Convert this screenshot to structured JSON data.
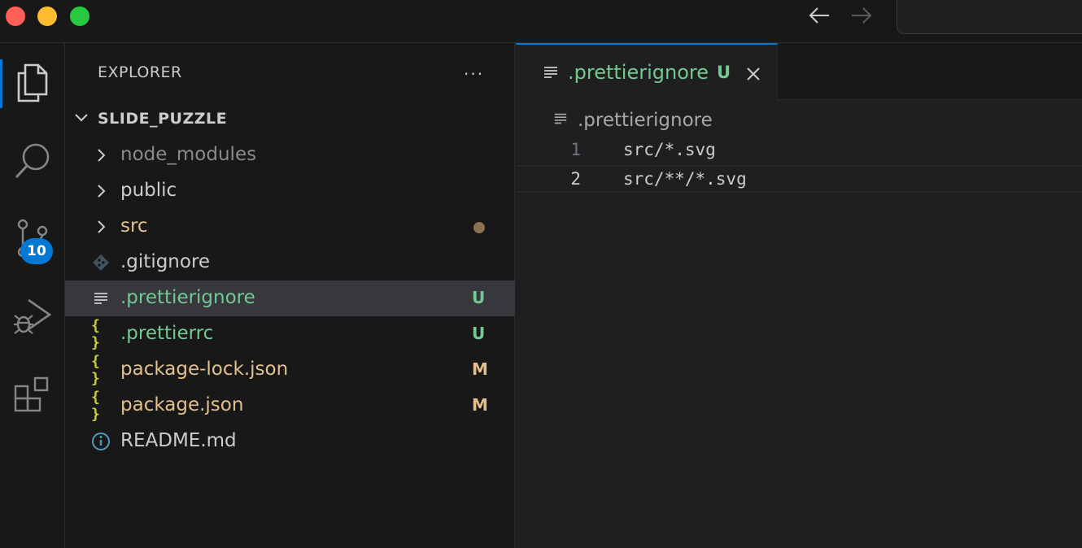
{
  "sidebar": {
    "title": "EXPLORER",
    "more": "···",
    "root": "SLIDE_PUZZLE",
    "items": [
      {
        "label": "node_modules",
        "type": "folder",
        "color": "#8b8b8b",
        "status": ""
      },
      {
        "label": "public",
        "type": "folder",
        "color": "#cccccc",
        "status": ""
      },
      {
        "label": "src",
        "type": "folder",
        "color": "#e2c08d",
        "status": "dot"
      },
      {
        "label": ".gitignore",
        "type": "git",
        "color": "#cccccc",
        "status": ""
      },
      {
        "label": ".prettierignore",
        "type": "text",
        "color": "#73c991",
        "status": "U"
      },
      {
        "label": ".prettierrc",
        "type": "json",
        "color": "#73c991",
        "status": "U"
      },
      {
        "label": "package-lock.json",
        "type": "json",
        "color": "#e2c08d",
        "status": "M"
      },
      {
        "label": "package.json",
        "type": "json",
        "color": "#e2c08d",
        "status": "M"
      },
      {
        "label": "README.md",
        "type": "info",
        "color": "#cccccc",
        "status": ""
      }
    ]
  },
  "activity": {
    "scm_badge": "10"
  },
  "editor": {
    "tab": {
      "label": ".prettierignore",
      "status": "U"
    },
    "breadcrumb": ".prettierignore",
    "lines": [
      {
        "num": "1",
        "code": "src/*.svg"
      },
      {
        "num": "2",
        "code": "src/**/*.svg"
      }
    ]
  },
  "colors": {
    "accent": "#0078d4",
    "untracked": "#73c991",
    "modified": "#e2c08d"
  }
}
